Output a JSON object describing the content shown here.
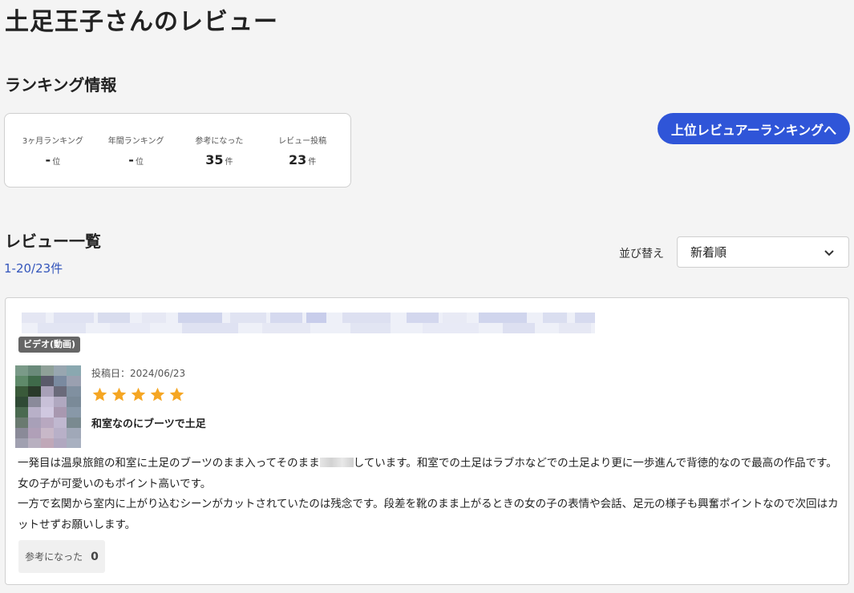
{
  "page": {
    "title": "土足王子さんのレビュー"
  },
  "ranking": {
    "section_title": "ランキング情報",
    "stats": [
      {
        "label": "3ヶ月ランキング",
        "value": "-",
        "unit": "位"
      },
      {
        "label": "年間ランキング",
        "value": "-",
        "unit": "位"
      },
      {
        "label": "参考になった",
        "value": "35",
        "unit": "件"
      },
      {
        "label": "レビュー投稿",
        "value": "23",
        "unit": "件"
      }
    ],
    "button_label": "上位レビュアーランキングへ"
  },
  "reviews": {
    "section_title": "レビュー一覧",
    "count_text": "1-20/23件",
    "sort_label": "並び替え",
    "sort_selected": "新着順",
    "items": [
      {
        "badge": "ビデオ(動画)",
        "date": "投稿日：2024/06/23",
        "rating": 5,
        "title": "和室なのにブーツで土足",
        "body": {
          "p1_before": "一発目は温泉旅館の和室に土足のブーツのまま入ってそのまま",
          "p1_after": "しています。和室での土足はラブホなどでの土足より更に一歩進んで背徳的なので最高の作品です。女の子が可愛いのもポイント高いです。",
          "p2": "一方で玄関から室内に上がり込むシーンがカットされていたのは残念です。段差を靴のまま上がるときの女の子の表情や会話、足元の様子も興奮ポイントなので次回はカットせずお願いします。"
        },
        "helpful_label": "参考になった",
        "helpful_count": "0"
      }
    ]
  },
  "colors": {
    "accent": "#2f55d8",
    "star": "#f5a623",
    "link": "#3355bb",
    "badge": "#666666"
  },
  "icons": {
    "sort": "chevron-down-icon",
    "rating": "star-icon"
  }
}
